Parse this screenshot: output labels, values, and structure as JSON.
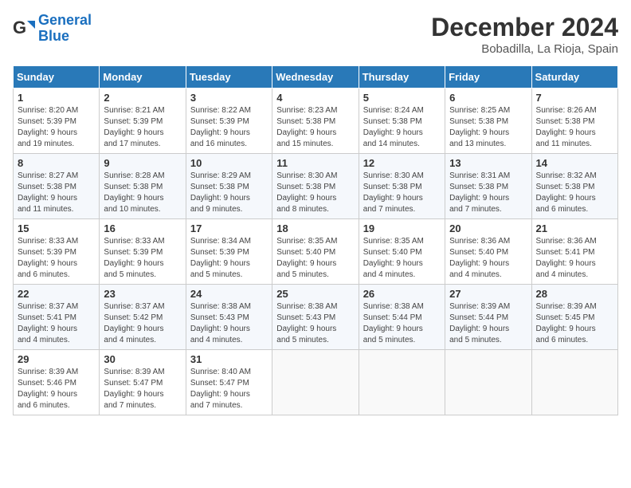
{
  "header": {
    "logo_line1": "General",
    "logo_line2": "Blue",
    "month": "December 2024",
    "location": "Bobadilla, La Rioja, Spain"
  },
  "days_of_week": [
    "Sunday",
    "Monday",
    "Tuesday",
    "Wednesday",
    "Thursday",
    "Friday",
    "Saturday"
  ],
  "weeks": [
    [
      {
        "day": "1",
        "sunrise": "8:20 AM",
        "sunset": "5:39 PM",
        "daylight": "9 hours and 19 minutes."
      },
      {
        "day": "2",
        "sunrise": "8:21 AM",
        "sunset": "5:39 PM",
        "daylight": "9 hours and 17 minutes."
      },
      {
        "day": "3",
        "sunrise": "8:22 AM",
        "sunset": "5:39 PM",
        "daylight": "9 hours and 16 minutes."
      },
      {
        "day": "4",
        "sunrise": "8:23 AM",
        "sunset": "5:38 PM",
        "daylight": "9 hours and 15 minutes."
      },
      {
        "day": "5",
        "sunrise": "8:24 AM",
        "sunset": "5:38 PM",
        "daylight": "9 hours and 14 minutes."
      },
      {
        "day": "6",
        "sunrise": "8:25 AM",
        "sunset": "5:38 PM",
        "daylight": "9 hours and 13 minutes."
      },
      {
        "day": "7",
        "sunrise": "8:26 AM",
        "sunset": "5:38 PM",
        "daylight": "9 hours and 11 minutes."
      }
    ],
    [
      {
        "day": "8",
        "sunrise": "8:27 AM",
        "sunset": "5:38 PM",
        "daylight": "9 hours and 11 minutes."
      },
      {
        "day": "9",
        "sunrise": "8:28 AM",
        "sunset": "5:38 PM",
        "daylight": "9 hours and 10 minutes."
      },
      {
        "day": "10",
        "sunrise": "8:29 AM",
        "sunset": "5:38 PM",
        "daylight": "9 hours and 9 minutes."
      },
      {
        "day": "11",
        "sunrise": "8:30 AM",
        "sunset": "5:38 PM",
        "daylight": "9 hours and 8 minutes."
      },
      {
        "day": "12",
        "sunrise": "8:30 AM",
        "sunset": "5:38 PM",
        "daylight": "9 hours and 7 minutes."
      },
      {
        "day": "13",
        "sunrise": "8:31 AM",
        "sunset": "5:38 PM",
        "daylight": "9 hours and 7 minutes."
      },
      {
        "day": "14",
        "sunrise": "8:32 AM",
        "sunset": "5:38 PM",
        "daylight": "9 hours and 6 minutes."
      }
    ],
    [
      {
        "day": "15",
        "sunrise": "8:33 AM",
        "sunset": "5:39 PM",
        "daylight": "9 hours and 6 minutes."
      },
      {
        "day": "16",
        "sunrise": "8:33 AM",
        "sunset": "5:39 PM",
        "daylight": "9 hours and 5 minutes."
      },
      {
        "day": "17",
        "sunrise": "8:34 AM",
        "sunset": "5:39 PM",
        "daylight": "9 hours and 5 minutes."
      },
      {
        "day": "18",
        "sunrise": "8:35 AM",
        "sunset": "5:40 PM",
        "daylight": "9 hours and 5 minutes."
      },
      {
        "day": "19",
        "sunrise": "8:35 AM",
        "sunset": "5:40 PM",
        "daylight": "9 hours and 4 minutes."
      },
      {
        "day": "20",
        "sunrise": "8:36 AM",
        "sunset": "5:40 PM",
        "daylight": "9 hours and 4 minutes."
      },
      {
        "day": "21",
        "sunrise": "8:36 AM",
        "sunset": "5:41 PM",
        "daylight": "9 hours and 4 minutes."
      }
    ],
    [
      {
        "day": "22",
        "sunrise": "8:37 AM",
        "sunset": "5:41 PM",
        "daylight": "9 hours and 4 minutes."
      },
      {
        "day": "23",
        "sunrise": "8:37 AM",
        "sunset": "5:42 PM",
        "daylight": "9 hours and 4 minutes."
      },
      {
        "day": "24",
        "sunrise": "8:38 AM",
        "sunset": "5:43 PM",
        "daylight": "9 hours and 4 minutes."
      },
      {
        "day": "25",
        "sunrise": "8:38 AM",
        "sunset": "5:43 PM",
        "daylight": "9 hours and 5 minutes."
      },
      {
        "day": "26",
        "sunrise": "8:38 AM",
        "sunset": "5:44 PM",
        "daylight": "9 hours and 5 minutes."
      },
      {
        "day": "27",
        "sunrise": "8:39 AM",
        "sunset": "5:44 PM",
        "daylight": "9 hours and 5 minutes."
      },
      {
        "day": "28",
        "sunrise": "8:39 AM",
        "sunset": "5:45 PM",
        "daylight": "9 hours and 6 minutes."
      }
    ],
    [
      {
        "day": "29",
        "sunrise": "8:39 AM",
        "sunset": "5:46 PM",
        "daylight": "9 hours and 6 minutes."
      },
      {
        "day": "30",
        "sunrise": "8:39 AM",
        "sunset": "5:47 PM",
        "daylight": "9 hours and 7 minutes."
      },
      {
        "day": "31",
        "sunrise": "8:40 AM",
        "sunset": "5:47 PM",
        "daylight": "9 hours and 7 minutes."
      },
      null,
      null,
      null,
      null
    ]
  ]
}
